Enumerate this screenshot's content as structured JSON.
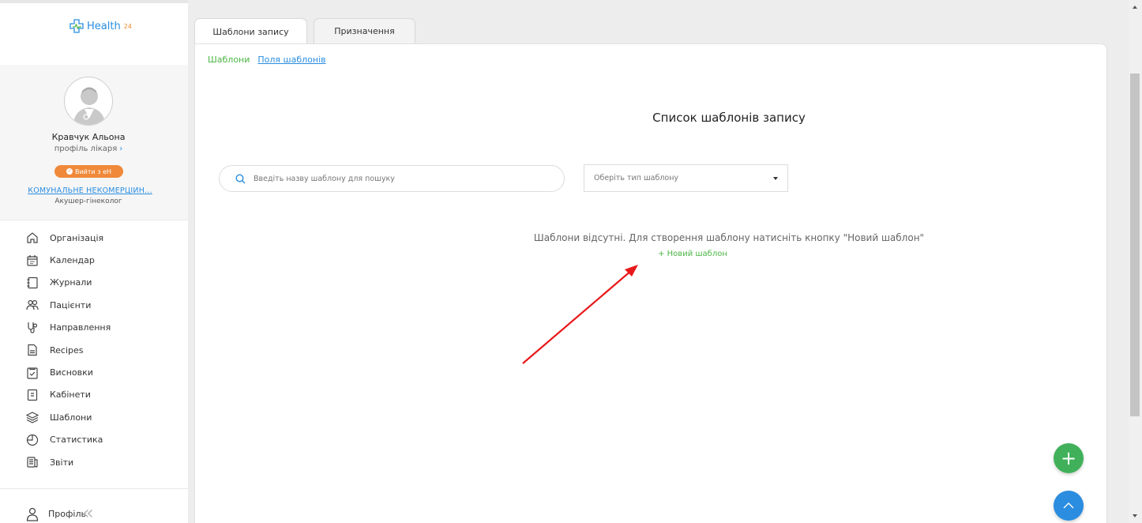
{
  "brand": {
    "name": "Health",
    "sup": "24"
  },
  "doctor": {
    "name": "Кравчук Альона",
    "profile_link": "профіль лікаря",
    "exit_badge": "Вийти з еН",
    "organization": "КОМУНАЛЬНЕ НЕКОМЕРЦІЙН...",
    "specialty": "Акушер-гінеколог"
  },
  "sidebar": {
    "items": [
      {
        "label": "Організація",
        "icon": "home-icon"
      },
      {
        "label": "Календар",
        "icon": "calendar-icon"
      },
      {
        "label": "Журнали",
        "icon": "journal-icon"
      },
      {
        "label": "Пацієнти",
        "icon": "patients-icon"
      },
      {
        "label": "Направлення",
        "icon": "stethoscope-icon"
      },
      {
        "label": "Recipes",
        "icon": "recipe-icon"
      },
      {
        "label": "Висновки",
        "icon": "checklist-icon"
      },
      {
        "label": "Кабінети",
        "icon": "door-icon"
      },
      {
        "label": "Шаблони",
        "icon": "layers-icon"
      },
      {
        "label": "Статистика",
        "icon": "clock-chart-icon"
      },
      {
        "label": "Звіти",
        "icon": "report-icon"
      }
    ],
    "profile_label": "Профіль"
  },
  "tabs": [
    {
      "label": "Шаблони запису",
      "active": true
    },
    {
      "label": "Призначення",
      "active": false
    }
  ],
  "subnav": {
    "active": "Шаблони",
    "link": "Поля шаблонів"
  },
  "main": {
    "title": "Список шаблонів запису",
    "search_placeholder": "Введіть назву шаблону для пошуку",
    "type_select": "Оберіть тип шаблону",
    "empty_message": "Шаблони відсутні. Для створення шаблону натисніть кнопку \"Новий шаблон\"",
    "new_template": "+ Новий шаблон"
  },
  "colors": {
    "green": "#4bb543",
    "blue": "#2a8de0",
    "orange": "#f0893a",
    "arrow": "#e8191b"
  }
}
